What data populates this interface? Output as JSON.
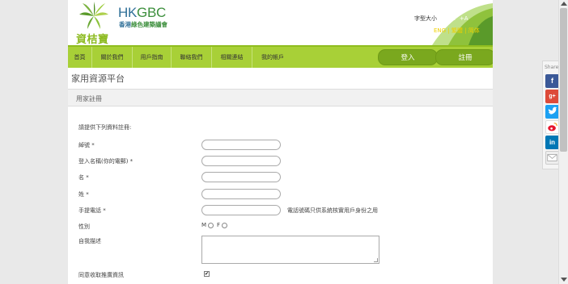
{
  "header": {
    "logo_zh": "資桔寶",
    "logo_hk": "HK",
    "logo_gbc": "GBC",
    "logo_sub_a": "香港",
    "logo_sub_b": "綠色建築議會",
    "font_size_label": "字型大小",
    "font_size_small": "-A",
    "font_size_mid": "A",
    "font_size_large": "+A",
    "lang_en": "ENG",
    "lang_sep1": "|",
    "lang_tc": "繁體",
    "lang_sep2": "|",
    "lang_sc": "简体"
  },
  "nav": {
    "items": [
      "首頁",
      "關於我們",
      "用戶指南",
      "聯絡我們",
      "相關連結",
      "我的帳戶"
    ],
    "login": "登入",
    "register": "註冊"
  },
  "page": {
    "platform_title": "家用資源平台",
    "section_title": "用家註冊",
    "instructions": "請提供下列資料註冊:"
  },
  "form": {
    "fields": [
      "綽號 *",
      "登入名稱(你的電郵) *",
      "名 *",
      "姓 *",
      "手提電話 *"
    ],
    "mobile_hint": "電話號碼只供系統核實用戶身份之用",
    "gender_label": "性別",
    "gender_m": "M",
    "gender_f": "F",
    "self_desc_label": "自我描述",
    "newsletter_label": "同意收取推廣資訊",
    "newsletter_checked": true
  },
  "share": {
    "label": "Share",
    "icons": [
      "facebook-icon",
      "google-plus-icon",
      "twitter-icon",
      "weibo-icon",
      "linkedin-icon",
      "email-icon"
    ],
    "colors": [
      "#3b5998",
      "#dd4b39",
      "#1da1f2",
      "#e6162d",
      "#0077b5",
      "#eeeeee"
    ]
  }
}
